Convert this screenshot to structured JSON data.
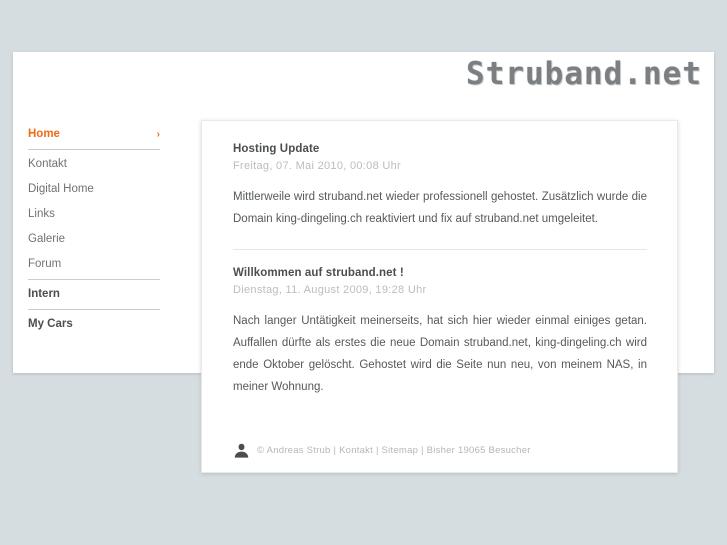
{
  "site": {
    "logo_text": "Struband.net",
    "background_color": "#d6dde0",
    "accent_color": "#ef6c16"
  },
  "sidebar": {
    "items": [
      {
        "label": "Home",
        "state": "active",
        "arrow": "›"
      },
      {
        "label": "Kontakt",
        "state": "normal"
      },
      {
        "label": "Digital Home",
        "state": "normal"
      },
      {
        "label": "Links",
        "state": "normal"
      },
      {
        "label": "Galerie",
        "state": "normal"
      },
      {
        "label": "Forum",
        "state": "normal"
      },
      {
        "label": "Intern",
        "state": "strong"
      },
      {
        "label": "My Cars",
        "state": "strong"
      }
    ]
  },
  "main": {
    "articles": [
      {
        "title": "Hosting Update",
        "date": "Freitag, 07. Mai 2010, 00:08 Uhr",
        "body": "Mittlerweile wird struband.net wieder professionell gehostet. Zusätzlich wurde die Domain king-dingeling.ch reaktiviert und fix auf struband.net umgeleitet."
      },
      {
        "title": "Willkommen auf struband.net !",
        "date": "Dienstag, 11. August 2009, 19:28 Uhr",
        "body": "Nach langer Untätigkeit meinerseits, hat sich hier wieder einmal einiges getan. Auffallen dürfte als erstes die neue Domain struband.net, king-dingeling.ch wird ende Oktober gelöscht. Gehostet wird die Seite nun neu, von meinem NAS, in meiner Wohnung."
      }
    ]
  },
  "footer": {
    "icon": "user-silhouette-icon",
    "text": "© Andreas Strub | Kontakt | Sitemap | Bisher 19065 Besucher"
  }
}
